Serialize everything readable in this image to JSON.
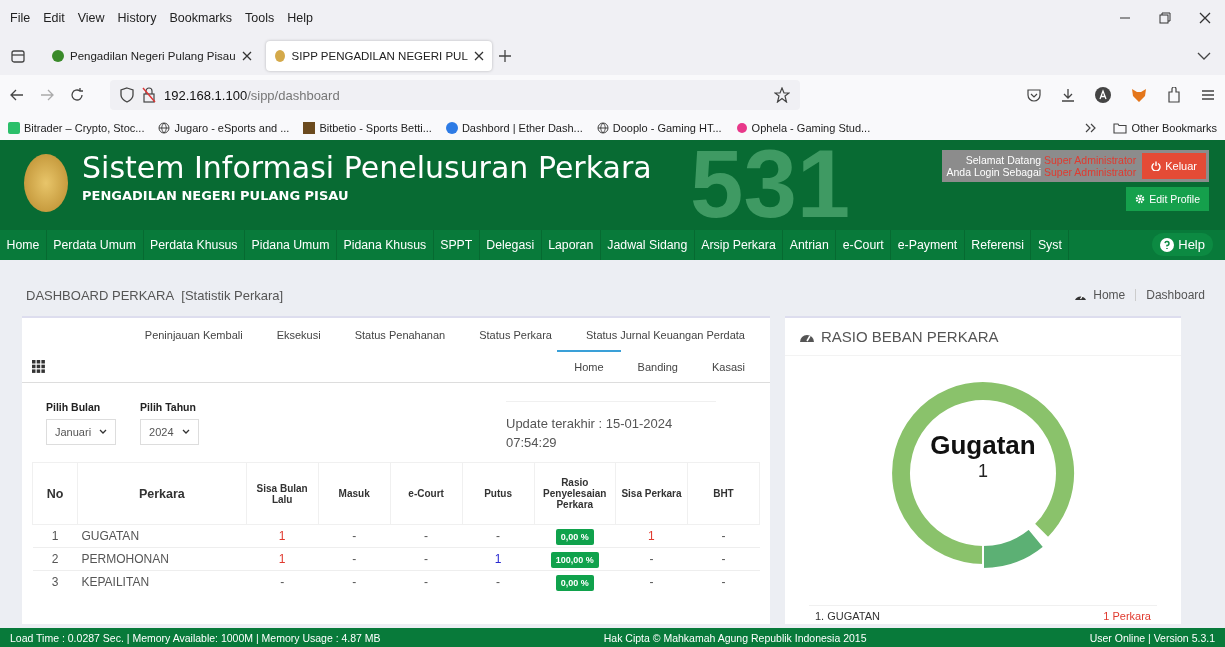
{
  "browser": {
    "menu": [
      "File",
      "Edit",
      "View",
      "History",
      "Bookmarks",
      "Tools",
      "Help"
    ],
    "tabs": [
      {
        "title": "Pengadilan Negeri Pulang Pisau",
        "selected": false
      },
      {
        "title": "SIPP PENGADILAN NEGERI PUL",
        "selected": true
      }
    ],
    "url": {
      "host": "192.168.1.100",
      "path": "/sipp/dashboard"
    },
    "bookmarks": [
      "Bitrader – Crypto, Stoc...",
      "Jugaro - eSports and ...",
      "Bitbetio - Sports Betti...",
      "Dashbord | Ether Dash...",
      "Dooplo - Gaming HT...",
      "Ophela - Gaming Stud..."
    ],
    "other_bookmarks": "Other Bookmarks"
  },
  "header": {
    "title": "Sistem Informasi Penelusuran Perkara",
    "subtitle": "PENGADILAN NEGERI PULANG PISAU",
    "background_number": "531",
    "welcome": {
      "line1_label": "Selamat Datang",
      "line1_user": "Super Administrator",
      "line2_label": "Anda Login Sebagai",
      "line2_role": "Super Administrator"
    },
    "logout": "Keluar",
    "edit_profile": "Edit Profile"
  },
  "nav": [
    "Home",
    "Perdata Umum",
    "Perdata Khusus",
    "Pidana Umum",
    "Pidana Khusus",
    "SPPT",
    "Delegasi",
    "Laporan",
    "Jadwal Sidang",
    "Arsip Perkara",
    "Antrian",
    "e-Court",
    "e-Payment",
    "Referensi",
    "Syst"
  ],
  "help": "Help",
  "page": {
    "title": "DASHBOARD PERKARA",
    "subtitle": "[Statistik Perkara]",
    "breadcrumb": [
      "Home",
      "Dashboard"
    ]
  },
  "stats_tabs": {
    "top": [
      {
        "label": "Peninjauan Kembali",
        "selected": false
      },
      {
        "label": "Eksekusi",
        "selected": false
      },
      {
        "label": "Status Penahanan",
        "selected": false
      },
      {
        "label": "Status Perkara",
        "selected": false
      },
      {
        "label": "Status Jurnal Keuangan Perdata",
        "selected": false
      }
    ],
    "bottom": [
      {
        "label": "Home",
        "selected": true
      },
      {
        "label": "Banding",
        "selected": false
      },
      {
        "label": "Kasasi",
        "selected": false
      }
    ]
  },
  "filters": [
    {
      "label": "Pilih Bulan",
      "value": "Januari"
    },
    {
      "label": "Pilih Tahun",
      "value": "2024"
    }
  ],
  "update": "Update terakhir : 15-01-2024 07:54:29",
  "table": {
    "columns": [
      "No",
      "Perkara",
      "Sisa Bulan Lalu",
      "Masuk",
      "e-Court",
      "Putus",
      "Rasio Penyelesaian Perkara",
      "Sisa Perkara",
      "BHT"
    ],
    "rows": [
      {
        "no": "1",
        "perkara": "GUGATAN",
        "sisa_bulan_lalu": "1",
        "masuk": "-",
        "ecourt": "-",
        "putus": "-",
        "rasio": "0,00 %",
        "sisa_perkara": "1",
        "bht": "-"
      },
      {
        "no": "2",
        "perkara": "PERMOHONAN",
        "sisa_bulan_lalu": "1",
        "masuk": "-",
        "ecourt": "-",
        "putus": "1",
        "rasio": "100,00 %",
        "sisa_perkara": "-",
        "bht": "-"
      },
      {
        "no": "3",
        "perkara": "KEPAILITAN",
        "sisa_bulan_lalu": "-",
        "masuk": "-",
        "ecourt": "-",
        "putus": "-",
        "rasio": "0,00 %",
        "sisa_perkara": "-",
        "bht": "-"
      }
    ]
  },
  "ratio_panel": {
    "title": "RASIO BEBAN PERKARA",
    "center_label": "Gugatan",
    "center_value": "1",
    "legend": [
      {
        "label": "1. GUGATAN",
        "value": "1 Perkara"
      }
    ]
  },
  "footer": {
    "left": "Load Time : 0.0287 Sec. | Memory Available: 1000M | Memory Usage : 4.87 MB",
    "center": "Hak Cipta © Mahkamah Agung Republik Indonesia 2015",
    "right": "User Online | Version 5.3.1"
  }
}
